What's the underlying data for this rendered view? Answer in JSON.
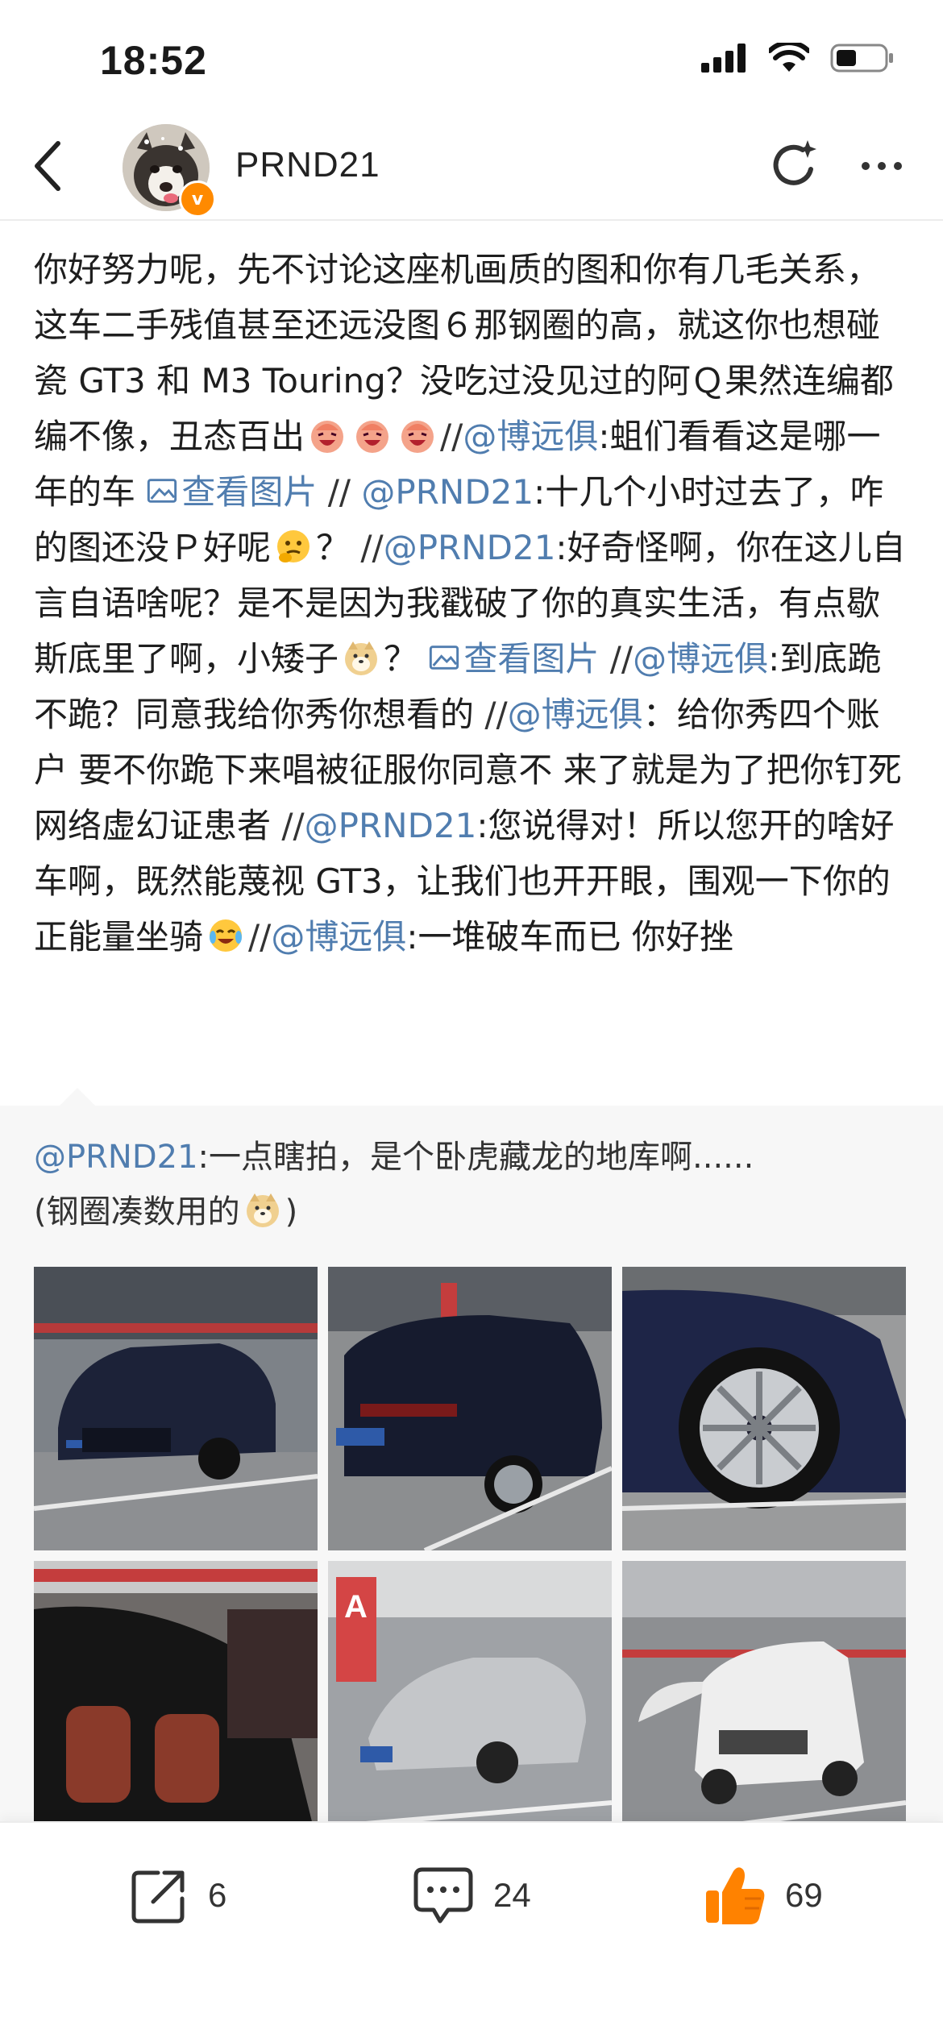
{
  "status": {
    "time": "18:52"
  },
  "header": {
    "username": "PRND21",
    "back_icon": "chevron-left-icon",
    "refresh_icon": "refresh-sparkle-icon",
    "more_icon": "more-horizontal-icon"
  },
  "post": {
    "s1": "你好努力呢，先不讨论这座机画质的图和你有几毛关系，这车二手残值甚至还远没图６那钢圈的高，就这你也想碰瓷 GT3 和 M3 Touring？没吃过没见过的阿Ｑ果然连编都编不像，丑态百出",
    "sep": "//",
    "m1": "@博远俱",
    "s2": ":蛆们看看这是哪一年的车 ",
    "view_image": "查看图片",
    "m2": "@PRND21",
    "s3": ":十几个小时过去了，咋的图还没Ｐ好呢",
    "s4": "？",
    "m3": "@PRND21",
    "s5": ":好奇怪啊，你在这儿自言自语啥呢？是不是因为我戳破了你的真实生活，有点歇斯底里了啊，小矮子",
    "s6": "？ ",
    "m4": "@博远俱",
    "s7": ":到底跪不跪？同意我给你秀你想看的 ",
    "m5": "@博远俱",
    "s8": "：给你秀四个账户 要不你跪下来唱被征服你同意不 来了就是为了把你钉死 网络虚幻证患者 ",
    "m6": "@PRND21",
    "s9": ":您说得对！所以您开的啥好车啊，既然能蔑视 GT3，让我们也开开眼，围观一下你的正能量坐骑",
    "m7": "@博远俱",
    "s10": ":一堆破车而已 你好挫"
  },
  "quote": {
    "mention": "@PRND21",
    "text": ":一点瞎拍，是个卧虎藏龙的地库啊......",
    "text2_a": "(钢圈凑数用的",
    "text2_b": ")"
  },
  "photos": [
    {
      "name": "dark-blue-bmw-m3-front"
    },
    {
      "name": "dark-blue-bmw-m3-rear"
    },
    {
      "name": "bmw-wheel-closeup"
    },
    {
      "name": "car-interior-red-seats"
    },
    {
      "name": "silver-porsche-911-gt3"
    },
    {
      "name": "white-toyota-land-cruiser-prado"
    }
  ],
  "actions": {
    "share": {
      "icon": "share-icon",
      "count": "6"
    },
    "comment": {
      "icon": "comment-icon",
      "count": "24"
    },
    "like": {
      "icon": "thumbs-up-icon",
      "count": "69",
      "color": "#ff8200"
    }
  }
}
